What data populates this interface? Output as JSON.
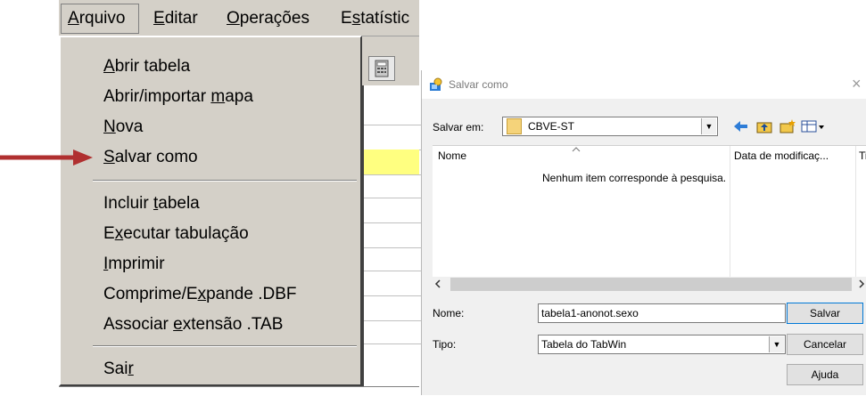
{
  "menubar": {
    "items": [
      {
        "label": "Arquivo",
        "accel": "A",
        "rest": "rquivo"
      },
      {
        "label": "Editar",
        "accel": "E",
        "rest": "ditar"
      },
      {
        "label": "Operações",
        "accel": "O",
        "rest": "perações"
      },
      {
        "label": "Estatístic",
        "pre": "E",
        "accel": "s",
        "rest": "tatístic"
      }
    ]
  },
  "file_menu": {
    "items": [
      {
        "pre": "",
        "accel": "A",
        "post": "brir tabela"
      },
      {
        "pre": "Abrir/importar ",
        "accel": "m",
        "post": "apa"
      },
      {
        "pre": "",
        "accel": "N",
        "post": "ova"
      },
      {
        "pre": "",
        "accel": "S",
        "post": "alvar como"
      },
      {
        "pre": "Incluir ",
        "accel": "t",
        "post": "abela"
      },
      {
        "pre": "E",
        "accel": "x",
        "post": "ecutar tabulação"
      },
      {
        "pre": "",
        "accel": "I",
        "post": "mprimir"
      },
      {
        "pre": "Comprime/E",
        "accel": "x",
        "post": "pande .DBF"
      },
      {
        "pre": "Associar ",
        "accel": "e",
        "post": "xtensão .TAB"
      },
      {
        "pre": "Sai",
        "accel": "r",
        "post": ""
      }
    ]
  },
  "annotation": {
    "arrow_color": "#b03030"
  },
  "dialog": {
    "title": "Salvar como",
    "close_label": "×",
    "save_in_label": "Salvar em:",
    "save_in_value": "CBVE-ST",
    "columns": {
      "name": "Nome",
      "date": "Data de modificaç...",
      "type": "Ti"
    },
    "empty_message": "Nenhum item corresponde à pesquisa.",
    "filename_label": "Nome:",
    "filename_value": "tabela1-anonot.sexo",
    "type_label": "Tipo:",
    "type_value": "Tabela do TabWin",
    "buttons": {
      "save": "Salvar",
      "cancel": "Cancelar",
      "help": "Ajuda"
    }
  }
}
